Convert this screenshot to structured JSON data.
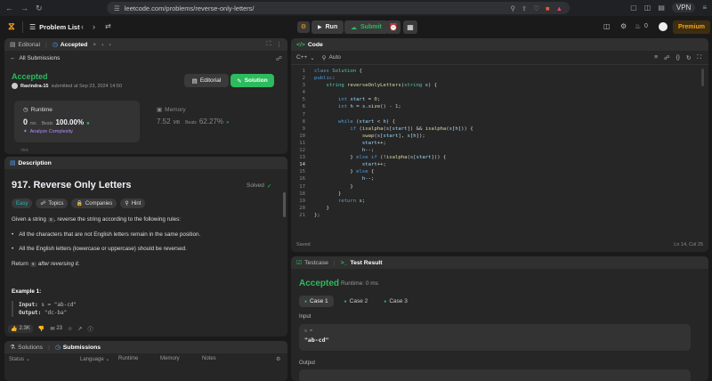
{
  "browser": {
    "url": "leetcode.com/problems/reverse-only-letters/",
    "vpn": "VPN"
  },
  "topbar": {
    "problem_list": "Problem List",
    "run": "Run",
    "submit": "Submit",
    "notif_count": "0",
    "premium": "Premium"
  },
  "left_top": {
    "tabs": [
      {
        "label": "Editorial"
      },
      {
        "label": "Accepted"
      }
    ],
    "all_submissions": "All Submissions",
    "status": "Accepted",
    "user": "Ravindra-15",
    "submitted_at": "submitted at Sep 23, 2024 14:50",
    "editorial_btn": "Editorial",
    "solution_btn": "Solution",
    "runtime_label": "Runtime",
    "runtime_value": "0",
    "runtime_unit": "ms",
    "runtime_beats_label": "Beats",
    "runtime_beats": "100.00%",
    "analyze": "Analyze Complexity",
    "memory_label": "Memory",
    "memory_value": "7.52",
    "memory_unit": "MB",
    "memory_beats_label": "Beats",
    "memory_beats": "62.27%",
    "partial": "75%"
  },
  "description": {
    "tab": "Description",
    "title": "917. Reverse Only Letters",
    "solved": "Solved",
    "tags": [
      "Easy",
      "Topics",
      "Companies",
      "Hint"
    ],
    "intro_pre": "Given a string ",
    "intro_code": "s",
    "intro_post": ", reverse the string according to the following rules:",
    "rule1": "All the characters that are not English letters remain in the same position.",
    "rule2": "All the English letters (lowercase or uppercase) should be reversed.",
    "ret_pre": "Return ",
    "ret_code": "s",
    "ret_post": " after reversing it.",
    "example_title": "Example 1:",
    "ex_input_label": "Input:",
    "ex_input": "s = \"ab-cd\"",
    "ex_output_label": "Output:",
    "ex_output": "\"dc-ba\"",
    "likes": "2.3K",
    "comments": "23"
  },
  "submissions": {
    "tabs": [
      "Solutions",
      "Submissions"
    ],
    "columns": [
      "Status",
      "Language",
      "Runtime",
      "Memory",
      "Notes"
    ]
  },
  "code": {
    "tab": "Code",
    "language": "C++",
    "mode": "Auto",
    "saved": "Saved",
    "cursor": "Ln 14, Col 25",
    "lines": [
      "class Solution {",
      "public:",
      "    string reverseOnlyLetters(string s) {",
      "",
      "        int start = 0;",
      "        int h = s.size() - 1;",
      "",
      "        while (start < h) {",
      "            if (isalpha(s[start]) && isalpha(s[h])) {",
      "                swap(s[start], s[h]);",
      "                start++;",
      "                h--;",
      "            } else if (!isalpha(s[start])) {",
      "                start++;",
      "            } else {",
      "                h--;",
      "            }",
      "        }",
      "        return s;",
      "    }",
      "};"
    ]
  },
  "testresult": {
    "tabs": [
      "Testcase",
      "Test Result"
    ],
    "status": "Accepted",
    "runtime": "Runtime: 0 ms",
    "cases": [
      "Case 1",
      "Case 2",
      "Case 3"
    ],
    "input_label": "Input",
    "var": "s =",
    "input_value": "\"ab-cd\"",
    "output_label": "Output"
  },
  "colors": {
    "accent": "#2cbb5d",
    "premium": "#ffa116",
    "bg": "#1a1a1a",
    "panel": "#262626"
  }
}
